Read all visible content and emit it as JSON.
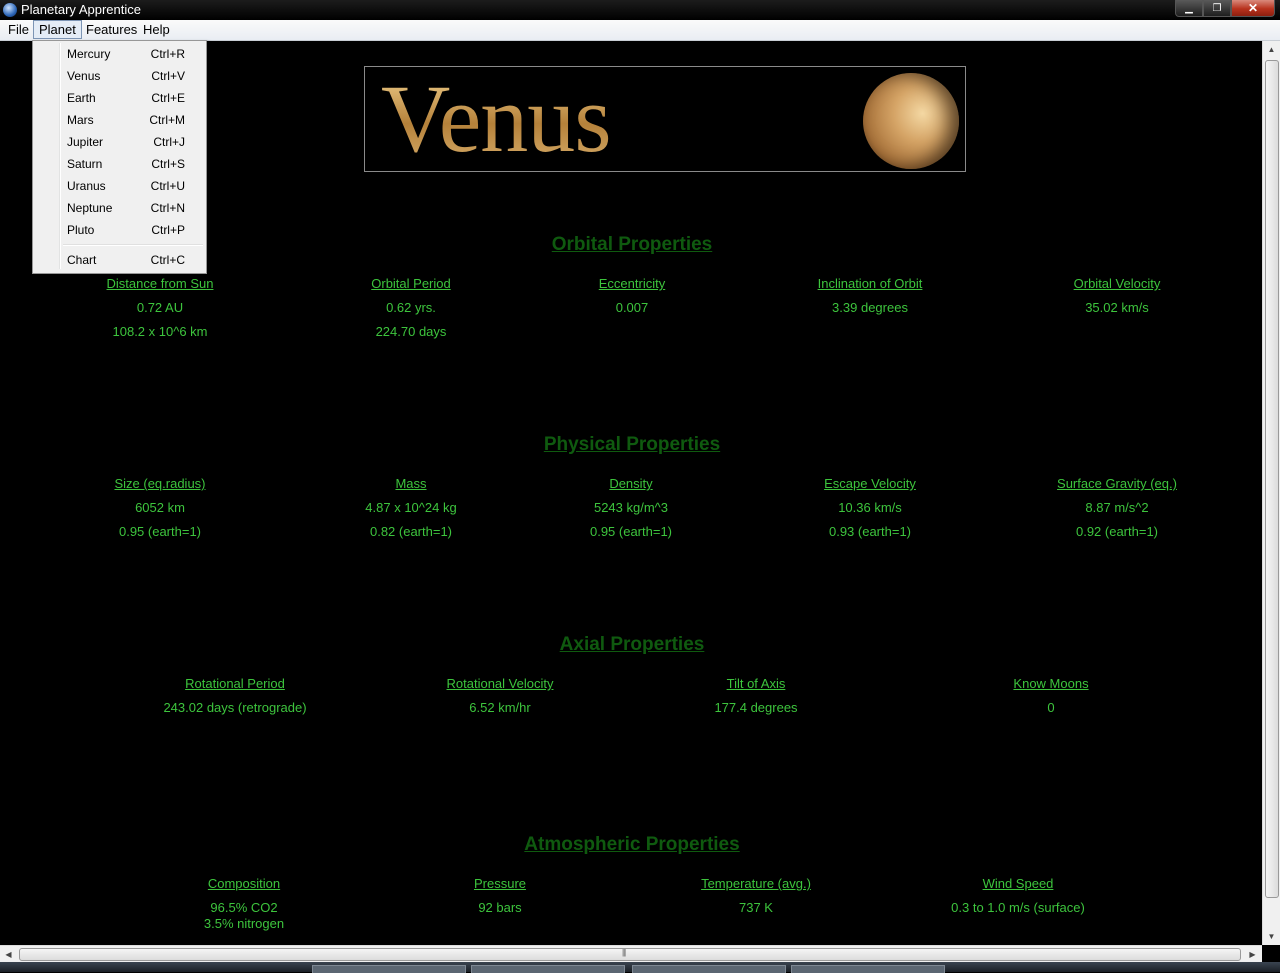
{
  "window": {
    "title": "Planetary Apprentice"
  },
  "menubar": {
    "items": [
      "File",
      "Planet",
      "Features",
      "Help"
    ]
  },
  "planet_menu": {
    "items": [
      {
        "label": "Mercury",
        "shortcut": "Ctrl+R"
      },
      {
        "label": "Venus",
        "shortcut": "Ctrl+V"
      },
      {
        "label": "Earth",
        "shortcut": "Ctrl+E"
      },
      {
        "label": "Mars",
        "shortcut": "Ctrl+M"
      },
      {
        "label": "Jupiter",
        "shortcut": "Ctrl+J"
      },
      {
        "label": "Saturn",
        "shortcut": "Ctrl+S"
      },
      {
        "label": "Uranus",
        "shortcut": "Ctrl+U"
      },
      {
        "label": "Neptune",
        "shortcut": "Ctrl+N"
      },
      {
        "label": "Pluto",
        "shortcut": "Ctrl+P"
      },
      {
        "label": "Chart",
        "shortcut": "Ctrl+C"
      }
    ]
  },
  "banner": {
    "planet_name": "Venus"
  },
  "orbital": {
    "title": "Orbital Properties",
    "columns": [
      {
        "header": "Distance from Sun",
        "values": [
          "0.72 AU",
          "108.2 x 10^6 km"
        ]
      },
      {
        "header": "Orbital Period",
        "values": [
          "0.62 yrs.",
          "224.70 days"
        ]
      },
      {
        "header": "Eccentricity",
        "values": [
          "0.007"
        ]
      },
      {
        "header": "Inclination of Orbit",
        "values": [
          "3.39 degrees"
        ]
      },
      {
        "header": "Orbital Velocity",
        "values": [
          "35.02 km/s"
        ]
      }
    ]
  },
  "physical": {
    "title": "Physical Properties",
    "columns": [
      {
        "header": "Size (eq.radius)",
        "values": [
          "6052 km",
          "0.95 (earth=1)"
        ]
      },
      {
        "header": "Mass",
        "values": [
          "4.87 x 10^24 kg",
          "0.82 (earth=1)"
        ]
      },
      {
        "header": "Density",
        "values": [
          "5243 kg/m^3",
          "0.95 (earth=1)"
        ]
      },
      {
        "header": "Escape Velocity",
        "values": [
          "10.36 km/s",
          "0.93 (earth=1)"
        ]
      },
      {
        "header": "Surface Gravity (eq.)",
        "values": [
          "8.87 m/s^2",
          "0.92 (earth=1)"
        ]
      }
    ]
  },
  "axial": {
    "title": "Axial Properties",
    "columns": [
      {
        "header": "Rotational Period",
        "values": [
          "243.02 days (retrograde)"
        ]
      },
      {
        "header": "Rotational Velocity",
        "values": [
          "6.52 km/hr"
        ]
      },
      {
        "header": "Tilt of Axis",
        "values": [
          "177.4 degrees"
        ]
      },
      {
        "header": "Know Moons",
        "values": [
          "0"
        ]
      }
    ]
  },
  "atmospheric": {
    "title": "Atmospheric Properties",
    "columns": [
      {
        "header": "Composition",
        "values": [
          "96.5% CO2",
          "3.5% nitrogen"
        ]
      },
      {
        "header": "Pressure",
        "values": [
          "92 bars"
        ]
      },
      {
        "header": "Temperature (avg.)",
        "values": [
          "737 K"
        ]
      },
      {
        "header": "Wind Speed",
        "values": [
          "0.3 to 1.0 m/s (surface)"
        ]
      }
    ]
  },
  "colors": {
    "heading": "#0f5a0f",
    "text": "#3dc43d",
    "background": "#000000"
  }
}
